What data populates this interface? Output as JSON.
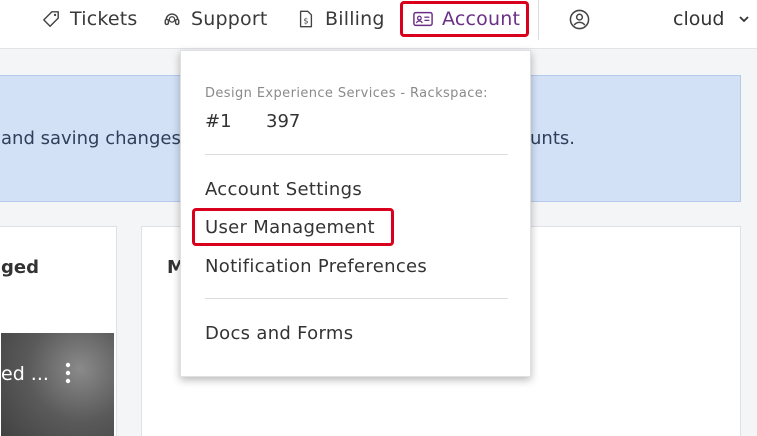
{
  "topnav": {
    "items": [
      {
        "label": "Tickets",
        "icon": "tag-icon"
      },
      {
        "label": "Support",
        "icon": "headset-icon"
      },
      {
        "label": "Billing",
        "icon": "dollar-document-icon"
      },
      {
        "label": "Account",
        "icon": "id-card-icon"
      }
    ],
    "user_label": "cloud",
    "account_color": "#6b2f87",
    "highlight_color": "#d9001e"
  },
  "banner": {
    "text_left": "and saving changes t",
    "text_right": "ounts."
  },
  "cards": {
    "left_title": "ged",
    "left_thumb_label": "ed ...",
    "right_title": "M"
  },
  "dropdown": {
    "account_name": "Design Experience Services - Rackspace:",
    "account_number_label": "#1",
    "account_number": "397",
    "items": [
      {
        "label": "Account Settings"
      },
      {
        "label": "User Management"
      },
      {
        "label": "Notification Preferences"
      },
      {
        "label": "Docs and Forms"
      }
    ]
  }
}
